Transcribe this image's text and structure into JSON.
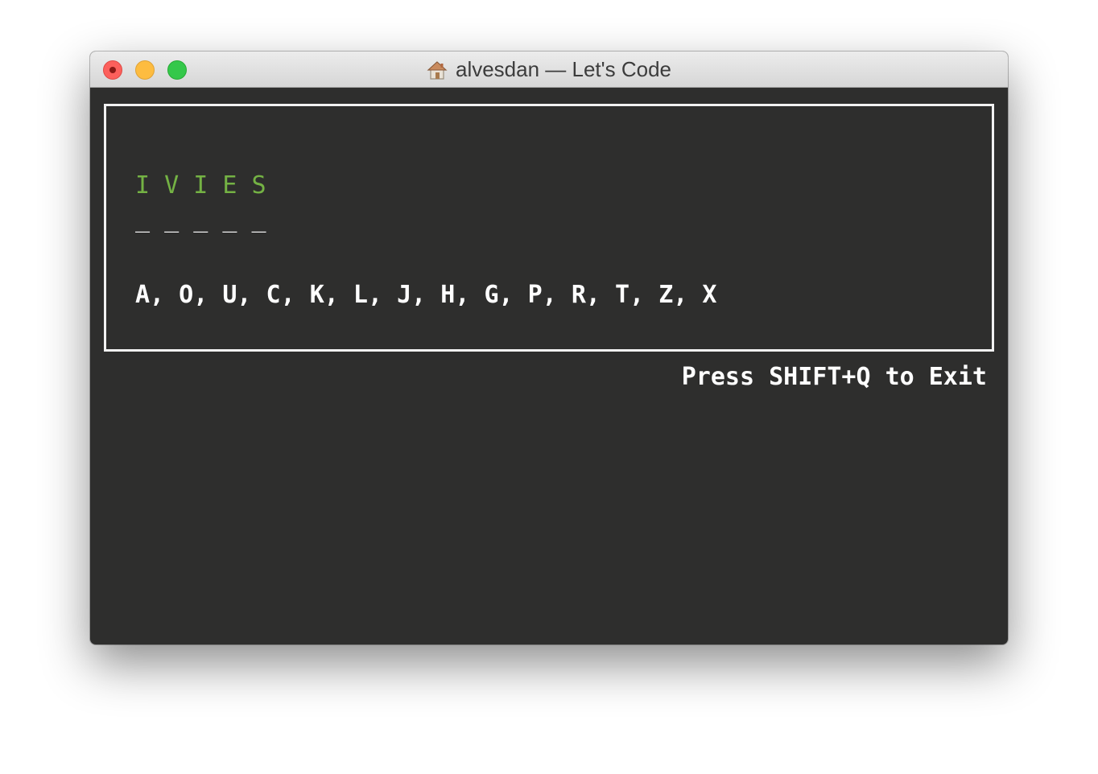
{
  "window": {
    "title": "alvesdan — Let's Code",
    "title_icon": "home-icon"
  },
  "game": {
    "word": "I V I E S",
    "blanks": "_ _ _ _ _",
    "guessed_letters": "A, O, U, C, K, L, J, H, G, P, R, T, Z, X",
    "exit_hint": "Press SHIFT+Q to Exit",
    "colors": {
      "background": "#2e2e2d",
      "word": "#74b244",
      "text": "#ffffff"
    }
  }
}
